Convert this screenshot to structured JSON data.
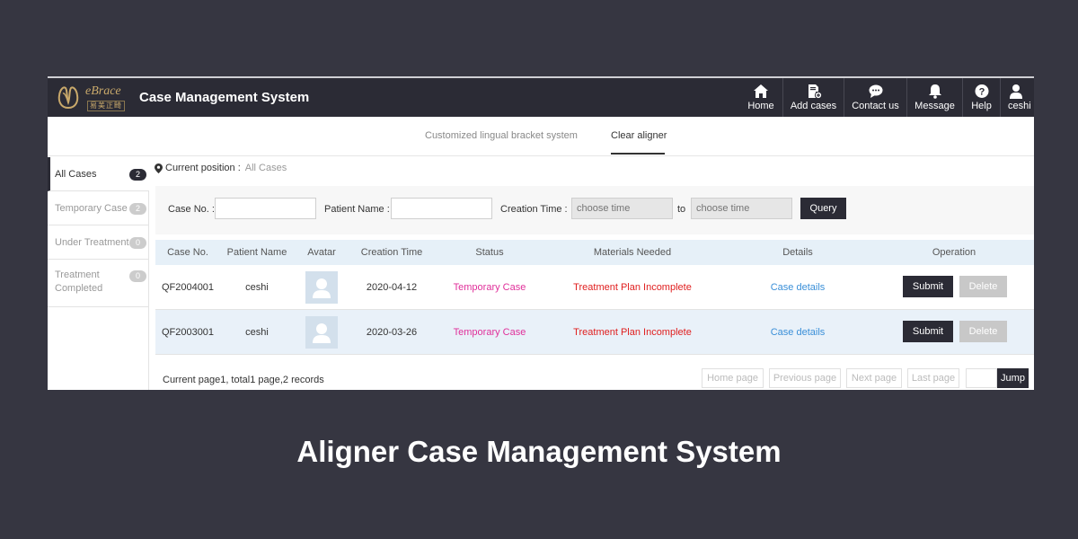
{
  "header": {
    "brand": "eBrace",
    "brand_cn": "易美正畸",
    "title": "Case Management System",
    "nav": [
      {
        "label": "Home",
        "icon": "home-icon"
      },
      {
        "label": "Add cases",
        "icon": "add-case-icon"
      },
      {
        "label": "Contact us",
        "icon": "chat-icon"
      },
      {
        "label": "Message",
        "icon": "bell-icon"
      },
      {
        "label": "Help",
        "icon": "help-icon"
      },
      {
        "label": "ceshi",
        "icon": "user-icon"
      }
    ]
  },
  "tabs": [
    {
      "label": "Customized lingual bracket system",
      "active": false
    },
    {
      "label": "Clear aligner",
      "active": true
    }
  ],
  "sidebar": [
    {
      "label": "All Cases",
      "count": "2",
      "active": true
    },
    {
      "label": "Temporary Case",
      "count": "2"
    },
    {
      "label": "Under Treatment",
      "count": "0"
    },
    {
      "label": "Treatment Completed",
      "count": "0"
    }
  ],
  "breadcrumb": {
    "label": "Current position :",
    "current": "All Cases"
  },
  "filter": {
    "case_no_label": "Case No. :",
    "patient_name_label": "Patient Name :",
    "creation_time_label": "Creation Time :",
    "from_placeholder": "choose time",
    "to_label": "to",
    "to_placeholder": "choose time",
    "query_label": "Query"
  },
  "table": {
    "columns": [
      "Case No.",
      "Patient Name",
      "Avatar",
      "Creation Time",
      "Status",
      "Materials Needed",
      "Details",
      "Operation"
    ],
    "rows": [
      {
        "case_no": "QF2004001",
        "patient": "ceshi",
        "created": "2020-04-12",
        "status": "Temporary Case",
        "materials": "Treatment Plan Incomplete",
        "details": "Case details",
        "submit": "Submit",
        "delete": "Delete"
      },
      {
        "case_no": "QF2003001",
        "patient": "ceshi",
        "created": "2020-03-26",
        "status": "Temporary Case",
        "materials": "Treatment Plan Incomplete",
        "details": "Case details",
        "submit": "Submit",
        "delete": "Delete"
      }
    ]
  },
  "pagination": {
    "info": "Current page1, total1 page,2 records",
    "home": "Home page",
    "previous": "Previous page",
    "next": "Next page",
    "last": "Last page",
    "jump": "Jump"
  },
  "caption": "Aligner Case Management System",
  "colors": {
    "dark": "#2b2b35",
    "background": "#363641",
    "status_pink": "#e0309a",
    "materials_red": "#e02020",
    "link_blue": "#3a8fd8",
    "brand_gold": "#c9a96b"
  }
}
